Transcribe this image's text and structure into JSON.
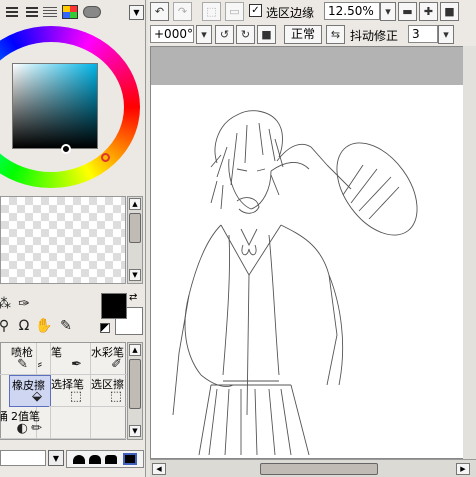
{
  "toolbar": {
    "selection_edge_label": "选区边缘",
    "selection_edge_checked": "✓",
    "zoom": "12.50%",
    "rotation": "+000°",
    "mode_label": "正常",
    "stabilizer_label": "抖动修正",
    "stabilizer_value": "3"
  },
  "brushes": [
    {
      "label": "",
      "icon": "brush-icon"
    },
    {
      "label": "喷枪",
      "icon": "airbrush-icon"
    },
    {
      "label": "笔",
      "icon": "pen-icon"
    },
    {
      "label": "水彩笔",
      "icon": "watercolor-icon"
    },
    {
      "label": "橡皮擦",
      "icon": "eraser-icon"
    },
    {
      "label": "选择笔",
      "icon": "select-pen-icon"
    },
    {
      "label": "选区擦",
      "icon": "select-eraser-icon"
    },
    {
      "label": "涌",
      "icon": "bucket-icon"
    },
    {
      "label": "2值笔",
      "icon": "binary-pen-icon"
    }
  ],
  "colors": {
    "foreground": "#000000",
    "background": "#ffffff",
    "selected_brush": "#cfd6f2"
  }
}
